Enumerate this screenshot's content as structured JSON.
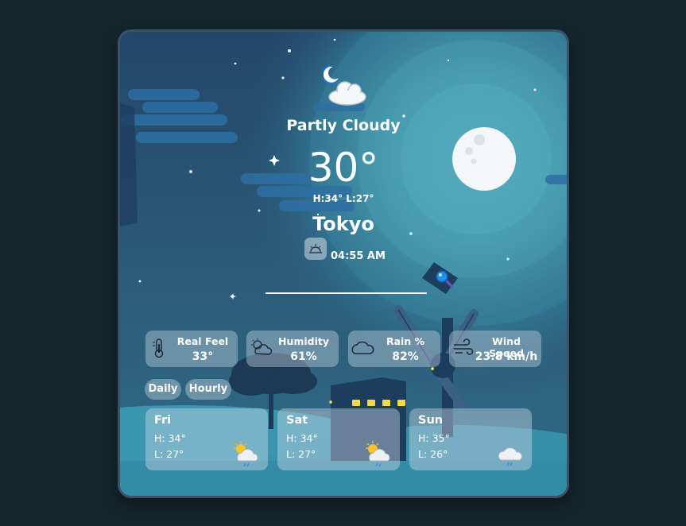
{
  "weather": {
    "condition": "Partly Cloudy",
    "temperature": "30°",
    "hilo": "H:34° L:27°",
    "city": "Tokyo",
    "sunrise_time": "04:55 AM",
    "icon": "night-partly-cloudy-icon"
  },
  "stats": [
    {
      "label": "Real Feel",
      "value": "33°",
      "icon": "thermometer-icon"
    },
    {
      "label": "Humidity",
      "value": "61%",
      "icon": "partly-cloudy-icon"
    },
    {
      "label": "Rain %",
      "value": "82%",
      "icon": "cloud-icon"
    },
    {
      "label": "Wind Speed",
      "value": "23.8 km/h",
      "icon": "wind-icon"
    }
  ],
  "tabs": [
    {
      "label": "Daily"
    },
    {
      "label": "Hourly"
    }
  ],
  "forecast": [
    {
      "day": "Fri",
      "high": "H: 34°",
      "low": "L: 27°",
      "icon": "sun-cloud-rain-icon"
    },
    {
      "day": "Sat",
      "high": "H: 34°",
      "low": "L: 27°",
      "icon": "sun-cloud-rain-icon"
    },
    {
      "day": "Sun",
      "high": "H: 35°",
      "low": "L: 26°",
      "icon": "cloud-rain-icon"
    }
  ],
  "colors": {
    "page_background": "#14252c",
    "sky_top": "#24466a",
    "sky_glow": "#4fa6b8",
    "moon": "#f3f6f8",
    "panel": "#c4d2e0"
  }
}
